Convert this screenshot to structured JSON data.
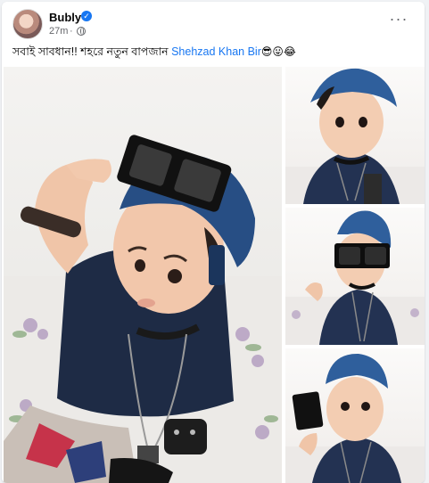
{
  "post": {
    "author": "Bubly",
    "time": "27m",
    "separator": "·",
    "caption_text": "সবাই সাবধান!! শহরে নতুন বাপজান ",
    "mention": "Shehzad Khan Bir",
    "caption_emojis": "😎😛😂"
  },
  "icons": {
    "verified": "verified-badge-icon",
    "privacy": "globe-icon",
    "menu": "more-horizontal-icon"
  },
  "colors": {
    "brand_blue": "#1877f2",
    "text": "#050505",
    "secondary_text": "#65676b"
  }
}
